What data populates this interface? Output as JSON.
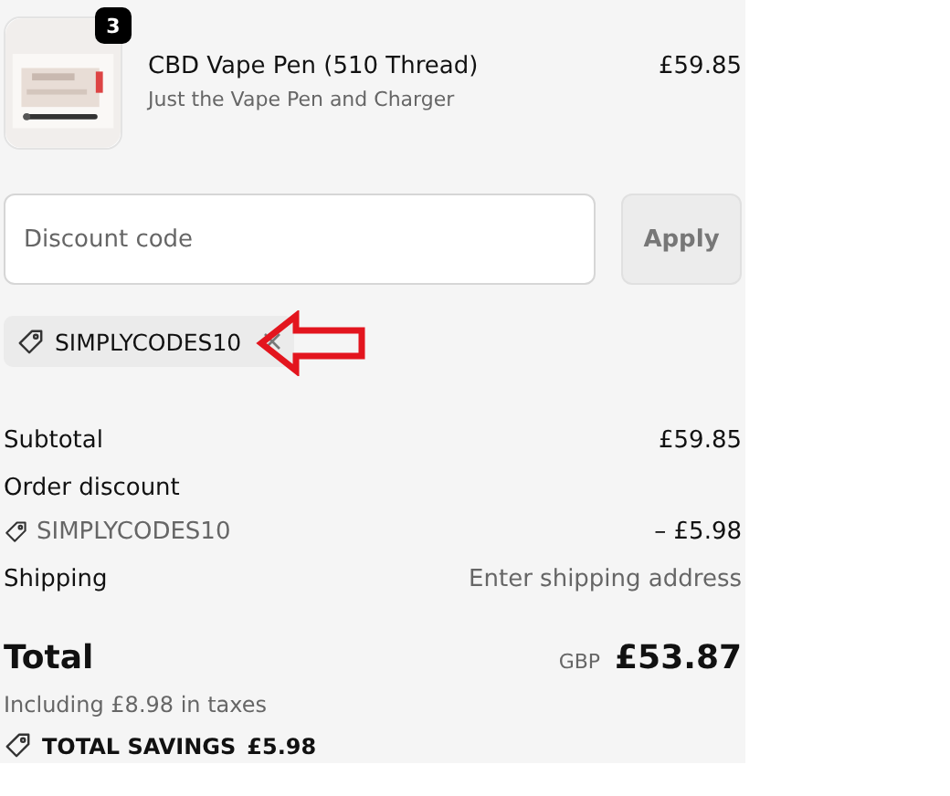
{
  "line_items": [
    {
      "kind": "picture",
      "quantity": "3",
      "title": "CBD Vape Pen (510 Thread)",
      "variant": "Just the Vape Pen and Charger",
      "price": "£59.85"
    }
  ],
  "discount": {
    "placeholder": "Discount code",
    "apply_label": "Apply",
    "apply_disabled": true
  },
  "applied_codes": [
    {
      "code": "SIMPLYCODES10"
    }
  ],
  "summary": {
    "subtotal_label": "Subtotal",
    "subtotal": "£59.85",
    "order_discount_label": "Order discount",
    "discount_code": "SIMPLYCODES10",
    "discount_amount": "– £5.98",
    "shipping_label": "Shipping",
    "shipping_value": "Enter shipping address",
    "total_label": "Total",
    "currency": "GBP",
    "total": "£53.87",
    "taxes_note": "Including £8.98 in taxes",
    "savings_label": "TOTAL SAVINGS",
    "savings_amount": "£5.98"
  }
}
